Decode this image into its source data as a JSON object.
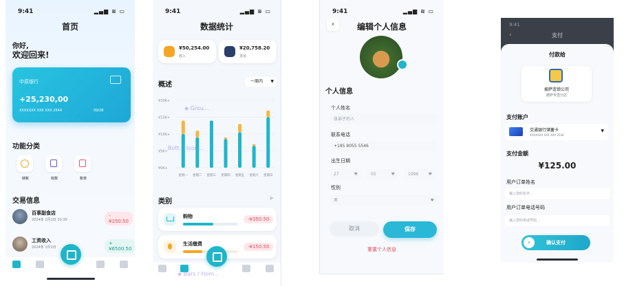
{
  "common": {
    "time": "9:41",
    "status_icons": "▂▄▆ ≋ ▭"
  },
  "screen1": {
    "title": "首页",
    "greeting": "你好,",
    "welcome": "欢迎回来!",
    "card": {
      "bank": "中原银行",
      "amount": "+25,230,00",
      "number": "XXXXXXX  XXX  XXX 2544",
      "expiry": "09/28"
    },
    "section_categories": "功能分类",
    "categories": [
      {
        "label": "转账",
        "icon": "transfer-icon"
      },
      {
        "label": "收款",
        "icon": "receive-icon"
      },
      {
        "label": "账单",
        "icon": "bill-icon"
      }
    ],
    "section_transactions": "交易信息",
    "transactions": [
      {
        "name": "百事副食店",
        "date": "2024年 1月1日 10:30",
        "amount": "-¥150.50"
      },
      {
        "name": "工资收入",
        "date": "2024年 1月1日",
        "amount": "+¥6500.50"
      }
    ]
  },
  "screen2": {
    "title": "数据统计",
    "stats": [
      {
        "amount": "¥50,254.00",
        "label": "收入",
        "color": "#f5a524"
      },
      {
        "amount": "¥20,758.20",
        "label": "支出",
        "color": "#2b6cb0"
      }
    ],
    "overview": "概述",
    "range": "一周内",
    "overlay_top": "◈ Grou...",
    "overlay_mid": "Bott...   Icon...",
    "section_category": "类别",
    "categories": [
      {
        "name": "购物",
        "amount": "-¥350.50",
        "progress": 0.55,
        "icon": "cart-icon",
        "color": "#1fb6c9"
      },
      {
        "name": "生活缴费",
        "amount": "-¥150.50",
        "progress": 0.35,
        "icon": "bill-drop-icon",
        "color": "#f5a524"
      }
    ],
    "overlay_bottom": "◈ Bars / Hom..."
  },
  "chart_data": {
    "type": "bar",
    "categories": [
      "星期一",
      "星期二",
      "星期三",
      "星期四",
      "星期五",
      "星期六",
      "星期日"
    ],
    "series": [
      {
        "values": [
          10,
          9,
          14,
          8.5,
          10.5,
          6.5,
          15
        ],
        "color": "#1fb6c9"
      },
      {
        "values": [
          14,
          11,
          14,
          9,
          13,
          7,
          17
        ],
        "color": "#f5b740"
      }
    ],
    "y_ticks": [
      "¥20K+",
      "¥15K+",
      "¥10K+",
      "¥5K+",
      "¥0K+"
    ],
    "ylim": [
      0,
      20
    ]
  },
  "screen3": {
    "title": "编辑个人信息",
    "section": "个人信息",
    "name_label": "个人姓名",
    "name_placeholder": "张弟子的人",
    "phone_label": "联系电话",
    "phone_value": "+185 8055 5546",
    "birth_label": "出生日期",
    "birth": [
      "27",
      "05",
      "1996"
    ],
    "gender_label": "性别",
    "gender_value": "男",
    "cancel": "取消",
    "save": "保存",
    "reset": "重置个人信息"
  },
  "screen4": {
    "back_time": "9:41",
    "back_title": "支付",
    "sheet_title": "付款给",
    "merchant": "披萨连锁公司",
    "merchant_sub": "披萨专营分店",
    "account_label": "支付账户",
    "bank_card": "交通银行储蓄卡",
    "bank_card_num": "XXXXXXX  XXX  XXX 2544",
    "amount_label": "支付金额",
    "amount": "¥125.00",
    "order_name_label": "用户订单姓名",
    "order_name_placeholder": "输入您的名字...",
    "order_phone_label": "用户订单电话号码",
    "order_phone_placeholder": "输入您的电话号码...",
    "confirm": "确认支付"
  }
}
